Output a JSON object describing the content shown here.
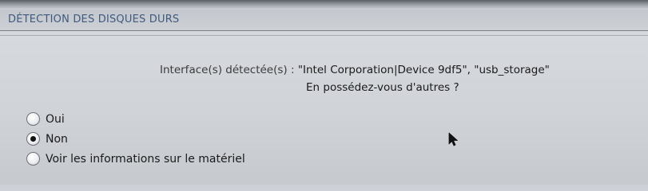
{
  "header": {
    "title": "DÉTECTION DES DISQUES DURS"
  },
  "message": {
    "line1_label": "Interface(s) détectée(s) : ",
    "line1_value": "\"Intel Corporation|Device 9df5\", \"usb_storage\"",
    "line2": "En possédez-vous d'autres ?"
  },
  "options": [
    {
      "label": "Oui",
      "checked": false
    },
    {
      "label": "Non",
      "checked": true
    },
    {
      "label": "Voir les informations sur le matériel",
      "checked": false
    }
  ],
  "icons": {
    "pointer": "mouse-pointer-icon"
  }
}
